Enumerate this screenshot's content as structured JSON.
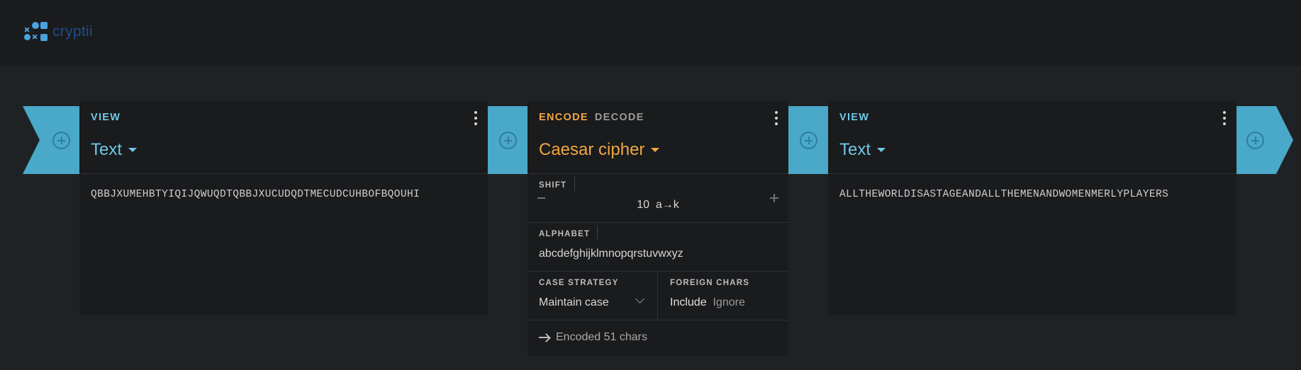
{
  "app": {
    "name": "cryptii"
  },
  "left_view": {
    "label": "VIEW",
    "format": "Text",
    "content": "QBBJXUMEHBTYIQIJQWUQDTQBBJXUCUDQDTMECUDCUHBOFBQOUHI"
  },
  "encoder": {
    "mode_active": "ENCODE",
    "mode_inactive": "DECODE",
    "title": "Caesar cipher",
    "shift": {
      "label": "SHIFT",
      "value": "10",
      "mapping": "a→k"
    },
    "alphabet": {
      "label": "ALPHABET",
      "value": "abcdefghijklmnopqrstuvwxyz"
    },
    "case_strategy": {
      "label": "CASE STRATEGY",
      "value": "Maintain case"
    },
    "foreign_chars": {
      "label": "FOREIGN CHARS",
      "options": [
        "Include",
        "Ignore"
      ],
      "selected": "Include"
    },
    "status": "Encoded 51 chars"
  },
  "right_view": {
    "label": "VIEW",
    "format": "Text",
    "content": "ALLTHEWORLDISASTAGEANDALLTHEMENANDWOMENMERLYPLAYERS"
  },
  "colors": {
    "view_accent": "#6ec8e6",
    "encoder_accent": "#f0a741",
    "connector": "#4aa8c9",
    "background": "#1f2224",
    "card": "#1a1b1d"
  }
}
